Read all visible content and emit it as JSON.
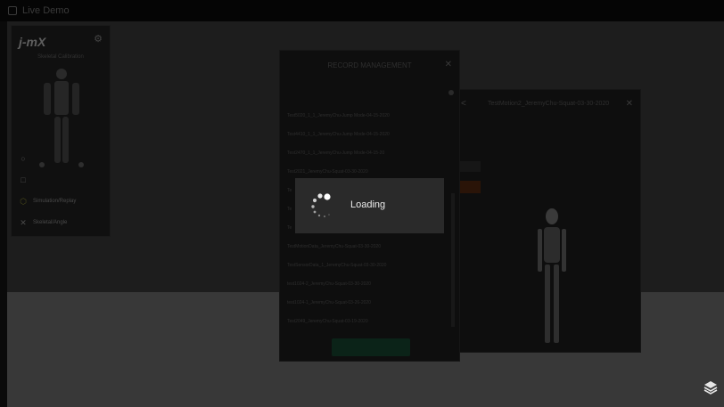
{
  "window": {
    "title": "Live Demo"
  },
  "left_panel": {
    "logo": "j-mX",
    "subtitle": "Skeletal Calibration",
    "menu": [
      {
        "label": "",
        "icon": "circle-icon"
      },
      {
        "label": "",
        "icon": "square-icon"
      },
      {
        "label": "Simulation/Replay",
        "icon": "hexagon-icon"
      },
      {
        "label": "Skeletal/Angle",
        "icon": "skeleton-icon"
      }
    ]
  },
  "record_management": {
    "title": "RECORD MANAGEMENT",
    "records": [
      "Test5020_1_1_JeremyChu-Jump Mode-04-15-2020",
      "Test4410_1_1_JeremyChu-Jump Mode-04-15-2020",
      "Test2470_1_1_JeremyChu-Jump Mode-04-15-20",
      "Test2021_JeremyChu-Squat-03-30-2020",
      "Te",
      "Te",
      "Te",
      "TestMotionData_JeremyChu-Squat-03-30-2020",
      "TestSensorData_1_JeremyChu-Squat-03-30-2020",
      "test1024-2_JeremyChu-Squat-03-30-2020",
      "test1024-1_JeremyChu-Squat-03-26-2020",
      "Test2049_JeremyChu-Squat-03-19-2020"
    ]
  },
  "preview": {
    "title": "TestMotion2_JeremyChu-Squat-03-30-2020"
  },
  "loading": {
    "label": "Loading"
  }
}
